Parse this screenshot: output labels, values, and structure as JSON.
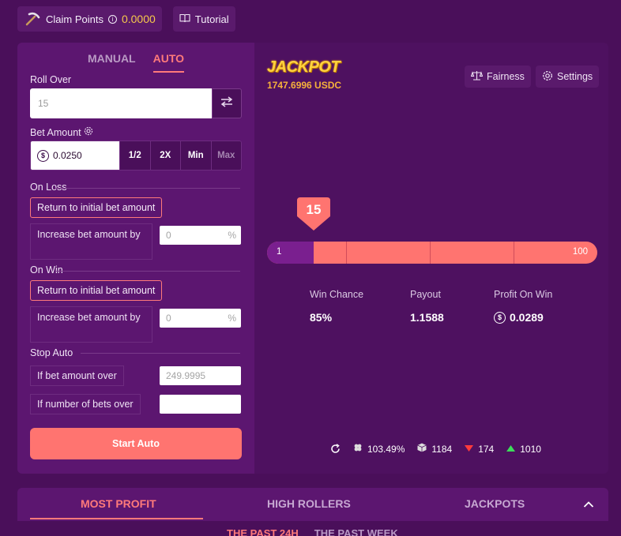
{
  "topbar": {
    "claim_label": "Claim Points",
    "claim_value": "0.0000",
    "tutorial_label": "Tutorial"
  },
  "bet_panel": {
    "tabs": [
      {
        "label": "MANUAL",
        "active": false
      },
      {
        "label": "AUTO",
        "active": true
      }
    ],
    "roll_over": {
      "label": "Roll Over",
      "placeholder": "15"
    },
    "bet_amount": {
      "label": "Bet Amount",
      "value": "0.0250",
      "half_label": "1/2",
      "double_label": "2X",
      "min_label": "Min",
      "max_label": "Max"
    },
    "on_loss": {
      "label": "On Loss",
      "return_label": "Return to initial bet amount",
      "increase_label": "Increase bet amount by",
      "increase_placeholder": "0",
      "unit": "%"
    },
    "on_win": {
      "label": "On Win",
      "return_label": "Return to initial bet amount",
      "increase_label": "Increase bet amount by",
      "increase_placeholder": "0",
      "unit": "%"
    },
    "stop_auto": {
      "label": "Stop Auto",
      "amount_over_label": "If bet amount over",
      "amount_over_placeholder": "249.9995",
      "bets_over_label": "If number of bets over",
      "bets_over_placeholder": ""
    },
    "start_label": "Start Auto"
  },
  "game": {
    "jackpot_title": "JACKPOT",
    "jackpot_amount": "1747.6996 USDC",
    "fairness_label": "Fairness",
    "settings_label": "Settings",
    "slider": {
      "min": "1",
      "max": "100",
      "marker": "15",
      "marker_value": 15
    },
    "stats": {
      "win_chance_label": "Win Chance",
      "win_chance": "85%",
      "payout_label": "Payout",
      "payout": "1.1588",
      "profit_label": "Profit On Win",
      "profit": "0.0289"
    },
    "footer": {
      "luck": "103.49%",
      "bets": "1184",
      "losses": "174",
      "wins": "1010"
    }
  },
  "leaderboard": {
    "tabs": [
      {
        "label": "MOST PROFIT",
        "active": true
      },
      {
        "label": "HIGH ROLLERS",
        "active": false
      },
      {
        "label": "JACKPOTS",
        "active": false
      }
    ],
    "subtabs": [
      {
        "label": "THE PAST 24H",
        "active": true
      },
      {
        "label": "THE PAST WEEK",
        "active": false
      }
    ]
  },
  "colors": {
    "background": "#4a0f5a",
    "accent": "#ff7470",
    "jackpot": "#ffd23f"
  }
}
